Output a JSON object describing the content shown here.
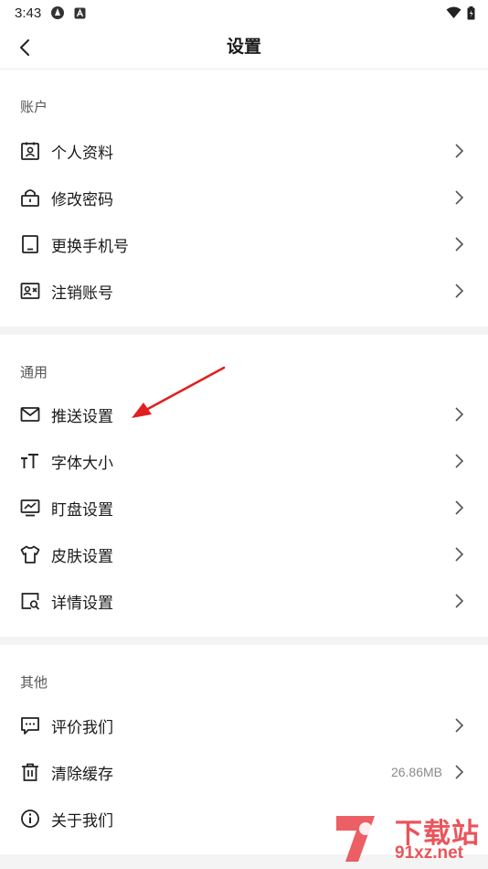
{
  "status_bar": {
    "time": "3:43"
  },
  "header": {
    "title": "设置"
  },
  "sections": {
    "account": {
      "title": "账户",
      "items": [
        {
          "label": "个人资料",
          "icon": "id-card-icon"
        },
        {
          "label": "修改密码",
          "icon": "lock-icon"
        },
        {
          "label": "更换手机号",
          "icon": "phone-icon"
        },
        {
          "label": "注销账号",
          "icon": "user-remove-card-icon"
        }
      ]
    },
    "general": {
      "title": "通用",
      "items": [
        {
          "label": "推送设置",
          "icon": "mail-icon"
        },
        {
          "label": "字体大小",
          "icon": "font-size-icon"
        },
        {
          "label": "盯盘设置",
          "icon": "monitor-chart-icon"
        },
        {
          "label": "皮肤设置",
          "icon": "shirt-icon"
        },
        {
          "label": "详情设置",
          "icon": "search-doc-icon"
        }
      ]
    },
    "other": {
      "title": "其他",
      "items": [
        {
          "label": "评价我们",
          "icon": "comment-icon"
        },
        {
          "label": "清除缓存",
          "icon": "trash-icon",
          "value": "26.86MB"
        },
        {
          "label": "关于我们",
          "icon": "info-icon"
        }
      ]
    }
  },
  "watermark": {
    "text": "下载站",
    "url_text": "91xz.net"
  },
  "colors": {
    "accent_arrow": "#e02020",
    "watermark": "#e8434a"
  }
}
